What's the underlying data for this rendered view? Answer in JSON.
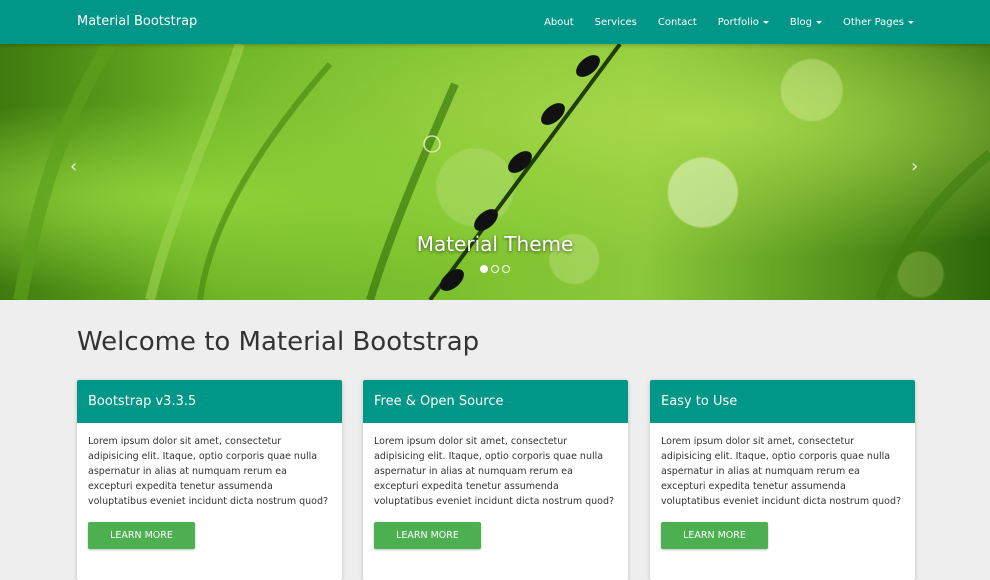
{
  "navbar": {
    "brand": "Material Bootstrap",
    "items": [
      {
        "label": "About",
        "dropdown": false
      },
      {
        "label": "Services",
        "dropdown": false
      },
      {
        "label": "Contact",
        "dropdown": false
      },
      {
        "label": "Portfolio",
        "dropdown": true
      },
      {
        "label": "Blog",
        "dropdown": true
      },
      {
        "label": "Other Pages",
        "dropdown": true
      }
    ],
    "color": "#009688"
  },
  "carousel": {
    "prev_glyph": "‹",
    "next_glyph": "›",
    "caption": "Material Theme",
    "slide_count": 3,
    "active_slide": 1
  },
  "main": {
    "title": "Welcome to Material Bootstrap",
    "cards": [
      {
        "heading": "Bootstrap v3.3.5",
        "body": "Lorem ipsum dolor sit amet, consectetur adipisicing elit. Itaque, optio corporis quae nulla aspernatur in alias at numquam rerum ea excepturi expedita tenetur assumenda voluptatibus eveniet incidunt dicta nostrum quod?",
        "button": "LEARN MORE"
      },
      {
        "heading": "Free & Open Source",
        "body": "Lorem ipsum dolor sit amet, consectetur adipisicing elit. Itaque, optio corporis quae nulla aspernatur in alias at numquam rerum ea excepturi expedita tenetur assumenda voluptatibus eveniet incidunt dicta nostrum quod?",
        "button": "LEARN MORE"
      },
      {
        "heading": "Easy to Use",
        "body": "Lorem ipsum dolor sit amet, consectetur adipisicing elit. Itaque, optio corporis quae nulla aspernatur in alias at numquam rerum ea excepturi expedita tenetur assumenda voluptatibus eveniet incidunt dicta nostrum quod?",
        "button": "LEARN MORE"
      }
    ],
    "button_color": "#4caf50"
  }
}
